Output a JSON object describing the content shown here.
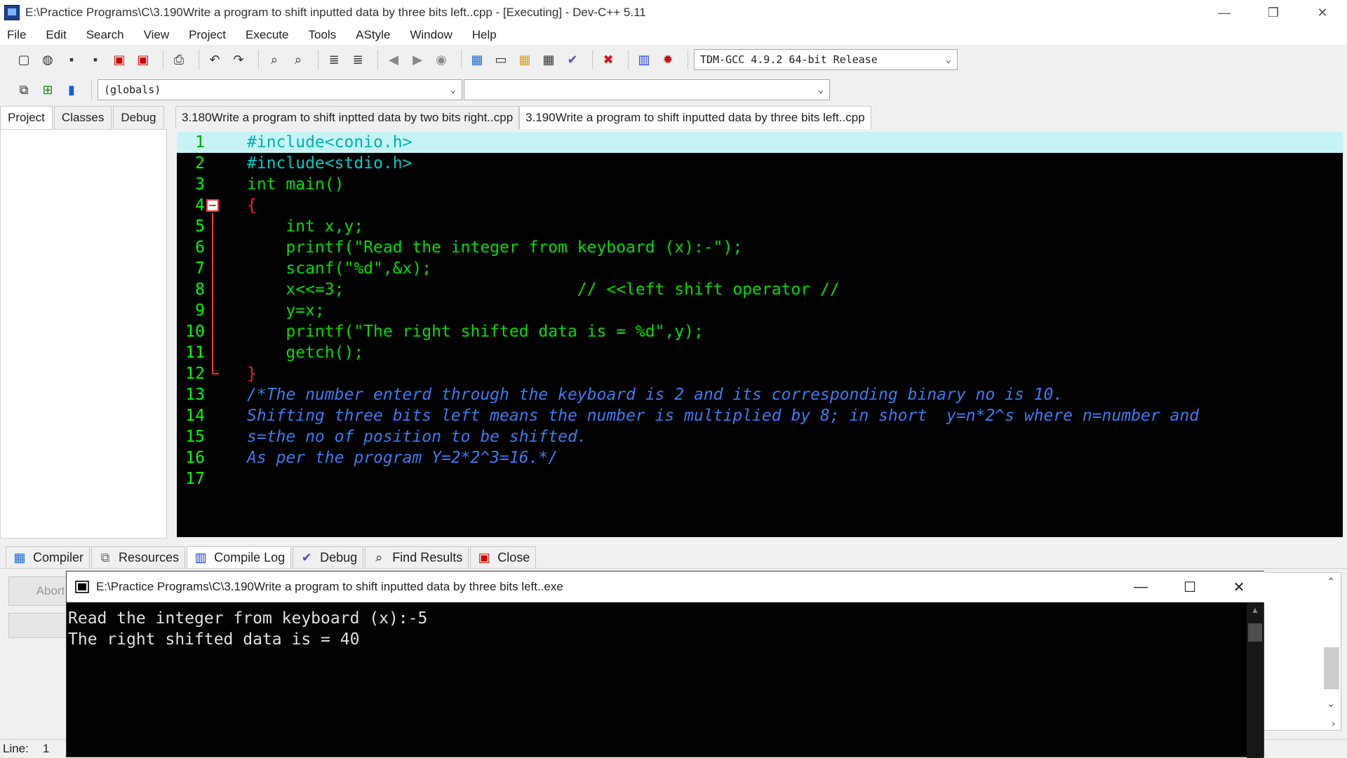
{
  "window": {
    "title": "E:\\Practice Programs\\C\\3.190Write a program to shift inputted data by three bits left..cpp - [Executing] - Dev-C++ 5.11",
    "minimize": "—",
    "restore": "❐",
    "close": "✕"
  },
  "menu": [
    "File",
    "Edit",
    "Search",
    "View",
    "Project",
    "Execute",
    "Tools",
    "AStyle",
    "Window",
    "Help"
  ],
  "toolbar": {
    "compiler_select": "TDM-GCC 4.9.2 64-bit Release",
    "scope_select": "(globals)",
    "function_select": ""
  },
  "left_tabs": [
    "Project",
    "Classes",
    "Debug"
  ],
  "editor_tabs": [
    "3.180Write a program to shift inptted data by two bits right..cpp",
    "3.190Write a program to shift inputted data by three bits left..cpp"
  ],
  "code_lines": [
    "#include<conio.h>",
    "#include<stdio.h>",
    "int main()",
    "{",
    "    int x,y;",
    "    printf(\"Read the integer from keyboard (x):-\");",
    "    scanf(\"%d\",&x);",
    "    x<<=3;                        // <<left shift operator //",
    "    y=x;",
    "    printf(\"The right shifted data is = %d\",y);",
    "    getch();",
    "}",
    "/*The number enterd through the keyboard is 2 and its corresponding binary no is 10.",
    "Shifting three bits left means the number is multiplied by 8; in short  y=n*2^s where n=number and",
    "s=the no of position to be shifted.",
    "As per the program Y=2*2^3=16.*/",
    ""
  ],
  "line_numbers": [
    "1",
    "2",
    "3",
    "4",
    "5",
    "6",
    "7",
    "8",
    "9",
    "10",
    "11",
    "12",
    "13",
    "14",
    "15",
    "16",
    "17"
  ],
  "bottom_tabs": [
    "Compiler",
    "Resources",
    "Compile Log",
    "Debug",
    "Find Results",
    "Close"
  ],
  "abort_button": "Abort",
  "status": {
    "line_label": "Line:",
    "line_value": "1"
  },
  "console": {
    "title": "E:\\Practice Programs\\C\\3.190Write a program to shift inputted data by three bits left..exe",
    "lines": [
      "Read the integer from keyboard (x):-5",
      "The right shifted data is = 40"
    ]
  },
  "colors": {
    "editor_bg": "#000000",
    "line_number": "#00ff00",
    "current_line": "#c6f4f4",
    "comment": "#3a7cf2",
    "symbol": "#ff2020"
  }
}
